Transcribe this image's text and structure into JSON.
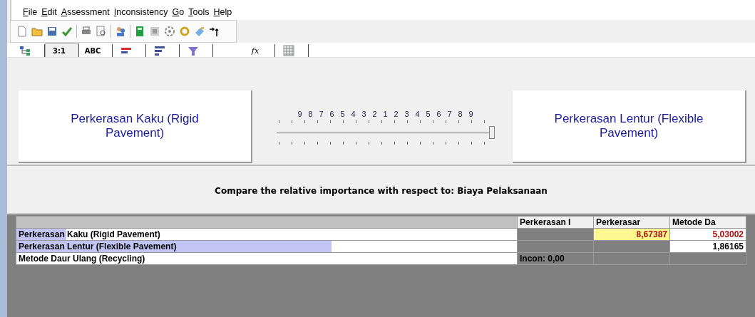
{
  "menu": [
    {
      "label": "File"
    },
    {
      "label": "Edit"
    },
    {
      "label": "Assessment"
    },
    {
      "label": "Inconsistency"
    },
    {
      "label": "Go"
    },
    {
      "label": "Tools"
    },
    {
      "label": "Help"
    }
  ],
  "tabs": [
    {
      "kind": "icon",
      "selected": false
    },
    {
      "kind": "text",
      "label": "3:1",
      "selected": true
    },
    {
      "kind": "text",
      "label": "ABC",
      "selected": false
    },
    {
      "kind": "icon",
      "selected": false
    },
    {
      "kind": "icon",
      "selected": false
    },
    {
      "kind": "icon",
      "selected": false
    },
    {
      "kind": "text",
      "label": "fx",
      "selected": false
    },
    {
      "kind": "icon",
      "selected": false
    }
  ],
  "comparison": {
    "left": "Perkerasan Kaku (Rigid Pavement)",
    "right": "Perkerasan Lentur (Flexible Pavement)",
    "scale": [
      "9",
      "8",
      "7",
      "6",
      "5",
      "4",
      "3",
      "2",
      "1",
      "2",
      "3",
      "4",
      "5",
      "6",
      "7",
      "8",
      "9"
    ],
    "level": 1
  },
  "prompt": "Compare the relative importance with respect to: Biaya Pelaksanaan",
  "table": {
    "columns": [
      "Perkerasan I",
      "Perkerasar",
      "Metode Da"
    ],
    "rows": [
      {
        "name": "Perkerasan Kaku (Rigid Pavement)",
        "level": 0.1,
        "cells": [
          {
            "kind": "empty"
          },
          {
            "kind": "value",
            "text": "8,67387",
            "inverted": true,
            "highlighted": true
          },
          {
            "kind": "value",
            "text": "5,03002",
            "inverted": true,
            "highlighted": false
          }
        ]
      },
      {
        "name": "Perkerasan Lentur (Flexible Pavement)",
        "level": 0.63,
        "cells": [
          {
            "kind": "empty"
          },
          {
            "kind": "empty"
          },
          {
            "kind": "value",
            "text": "1,86165",
            "inverted": false,
            "highlighted": false
          }
        ]
      },
      {
        "name": "Metode Daur Ulang (Recycling)",
        "level": 0,
        "cells": [
          {
            "kind": "incon",
            "text": "Incon: 0,00"
          },
          {
            "kind": "empty"
          },
          {
            "kind": "empty"
          }
        ]
      }
    ]
  }
}
